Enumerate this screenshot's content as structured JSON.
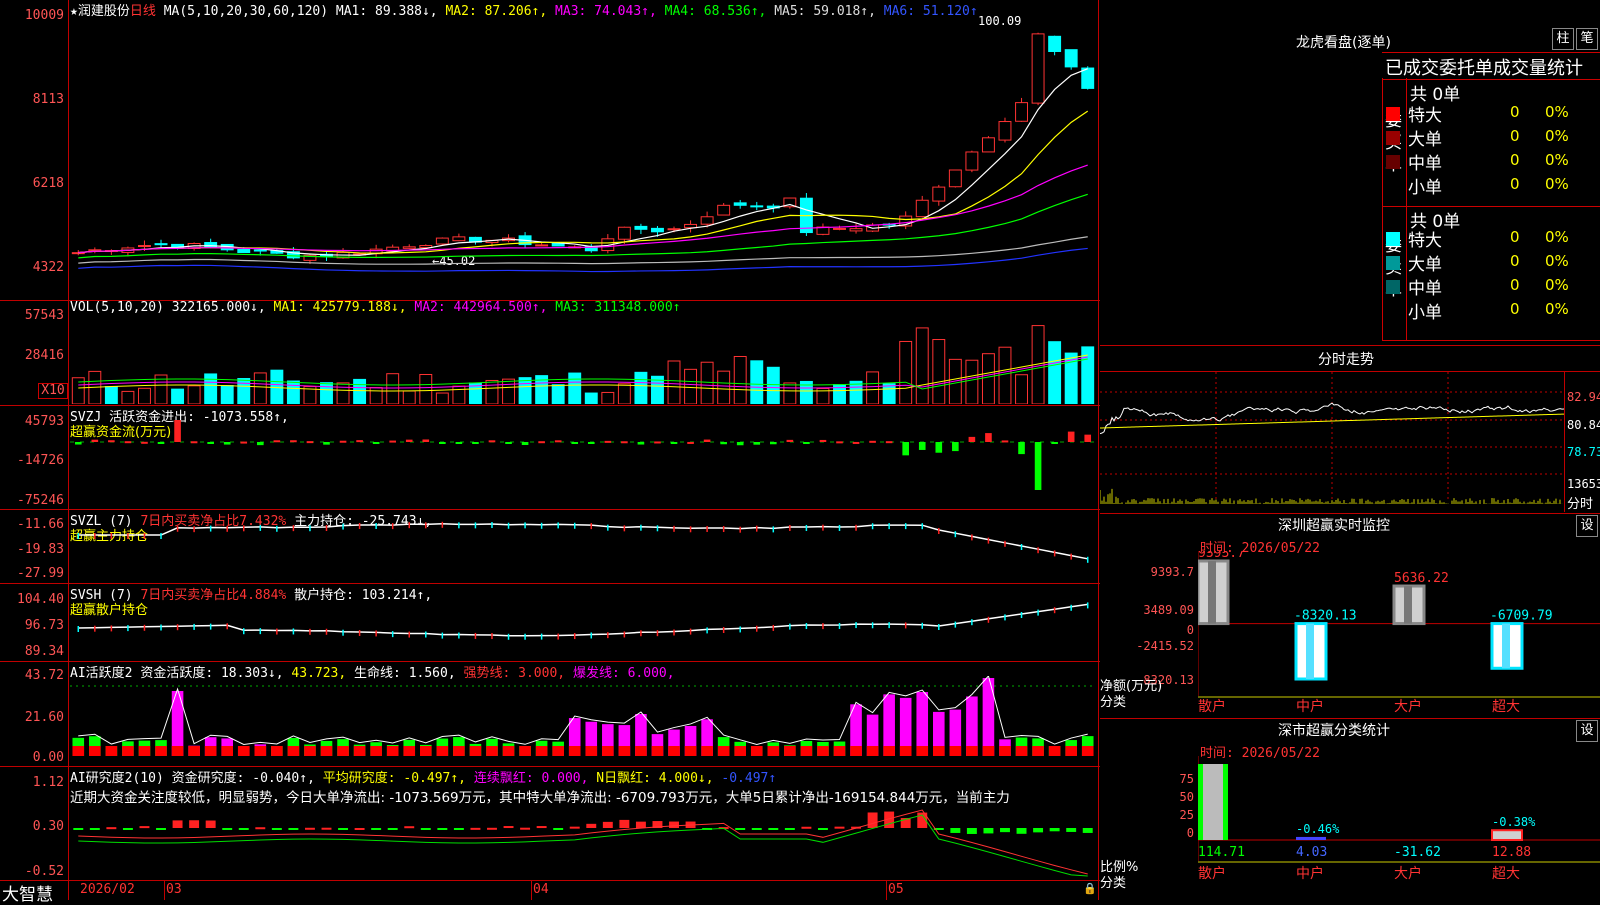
{
  "stock": {
    "star": "★",
    "name": "润建股份",
    "period": "日线"
  },
  "kline": {
    "ma_label": "MA(5,10,20,30,60,120)",
    "ma1": "MA1: 89.388↓,",
    "ma2": "MA2: 87.206↑,",
    "ma3": "MA3: 74.043↑,",
    "ma4": "MA4: 68.536↑,",
    "ma5": "MA5: 59.018↑,",
    "ma6": "MA6: 51.120↑",
    "y_ticks": [
      "10009",
      "8113",
      "6218",
      "4322"
    ],
    "high_mark": "100.09",
    "low_mark": "←45.02",
    "colors": {
      "up": "#ff3333",
      "down": "#00ffff",
      "ma1": "#ffffff",
      "ma2": "#ffff00",
      "ma3": "#ff00ff",
      "ma4": "#00ff00",
      "ma5": "#bbbbbb",
      "ma6": "#2233ff"
    }
  },
  "vol": {
    "label": "VOL(5,10,20)",
    "value": "322165.000↓,",
    "ma1": "MA1: 425779.188↓,",
    "ma2": "MA2: 442964.500↑,",
    "ma3": "MA3: 311348.000↑",
    "y_ticks": [
      "57543",
      "28416"
    ],
    "unit": "X10"
  },
  "svzj": {
    "label": "SVZJ",
    "desc": "活跃资金进出: -1073.558↑,",
    "sub": "超赢资金流(万元)",
    "y_ticks": [
      "45793",
      "-14726",
      "-75246"
    ]
  },
  "svzl": {
    "label": "SVZL (7)",
    "desc1": "7日内买卖净占比7.432%",
    "desc2": "主力持仓: -25.743↓,",
    "sub": "超赢主力持仓",
    "y_ticks": [
      "-11.66",
      "-19.83",
      "-27.99"
    ]
  },
  "svsh": {
    "label": "SVSH (7)",
    "desc1": "7日内买卖净占比4.884%",
    "desc2": "散户持仓: 103.214↑,",
    "sub": "超赢散户持仓",
    "y_ticks": [
      "104.40",
      "96.73",
      "89.34"
    ]
  },
  "ai1": {
    "label": "AI活跃度2",
    "desc1": "资金活跃度: 18.303↓,",
    "desc2": "43.723,",
    "desc3": "生命线: 1.560,",
    "desc4": "强势线: 3.000,",
    "desc5": "爆发线: 6.000,",
    "y_ticks": [
      "43.72",
      "21.60",
      "0.00"
    ]
  },
  "ai2": {
    "label": "AI研究度2(10)",
    "desc1": "资金研究度: -0.040↑,",
    "desc2": "平均研究度: -0.497↑,",
    "desc3": "连续飘红: 0.000,",
    "desc4": "N日飘红: 4.000↓,",
    "desc5": "-0.497↑",
    "text": "近期大资金关注度较低，明显弱势，今日大单净流出: -1073.569万元，其中特大单净流出: -6709.793万元，大单5日累计净出-169154.844万元，当前主力",
    "y_ticks": [
      "1.12",
      "0.30",
      "-0.52"
    ]
  },
  "bottom": {
    "brand": "大智慧",
    "dates": [
      "2026/02",
      "03",
      "04",
      "05"
    ]
  },
  "longhu": {
    "title": "龙虎看盘(逐单)",
    "btn1": "柱",
    "btn2": "笔",
    "header": "已成交委托单成交量统计",
    "buy": {
      "side": "委买单",
      "total": "共 0单",
      "rows": [
        {
          "name": "特大",
          "v": "0",
          "p": "0%",
          "c": "#ff0000"
        },
        {
          "name": "大单",
          "v": "0",
          "p": "0%",
          "c": "#990000"
        },
        {
          "name": "中单",
          "v": "0",
          "p": "0%",
          "c": "#660000"
        },
        {
          "name": "小单",
          "v": "0",
          "p": "0%",
          "c": "#000000"
        }
      ]
    },
    "sell": {
      "side": "委卖单",
      "total": "共 0单",
      "rows": [
        {
          "name": "特大",
          "v": "0",
          "p": "0%",
          "c": "#00ffff"
        },
        {
          "name": "大单",
          "v": "0",
          "p": "0%",
          "c": "#009999"
        },
        {
          "name": "中单",
          "v": "0",
          "p": "0%",
          "c": "#006666"
        },
        {
          "name": "小单",
          "v": "0",
          "p": "0%",
          "c": "#000000"
        }
      ]
    }
  },
  "fenshi": {
    "title": "分时走势",
    "y_ticks": [
      "82.94",
      "80.84",
      "78.73",
      "13653"
    ],
    "footer": "分时"
  },
  "monitor": {
    "title": "深圳超赢实时监控",
    "btn": "设",
    "time": "时间: 2026/05/22",
    "y_ticks": [
      "9393.7",
      "3489.09",
      "0",
      "-2415.52",
      "-8320.13"
    ],
    "ylabel": "净额(万元)",
    "xlabel": "分类",
    "bars": [
      {
        "cat": "散户",
        "value": 9393.7,
        "label": "9393.7"
      },
      {
        "cat": "中户",
        "value": -8320.13,
        "label": "-8320.13"
      },
      {
        "cat": "大户",
        "value": 5636.22,
        "label": "5636.22"
      },
      {
        "cat": "超大",
        "value": -6709.79,
        "label": "-6709.79"
      }
    ]
  },
  "stats": {
    "title": "深市超赢分类统计",
    "btn": "设",
    "time": "时间: 2026/05/22",
    "ylabel": "比例%",
    "xlabel": "分类",
    "y_ticks": [
      "75",
      "50",
      "25",
      "0"
    ],
    "bars": [
      {
        "cat": "散户",
        "value": 114.71,
        "label": "114.71",
        "top": ""
      },
      {
        "cat": "中户",
        "value": 4.03,
        "label": "4.03",
        "top": "-0.46%"
      },
      {
        "cat": "大户",
        "value": -31.62,
        "label": "-31.62",
        "top": ""
      },
      {
        "cat": "超大",
        "value": 12.88,
        "label": "12.88",
        "top": "-0.38%"
      }
    ]
  }
}
